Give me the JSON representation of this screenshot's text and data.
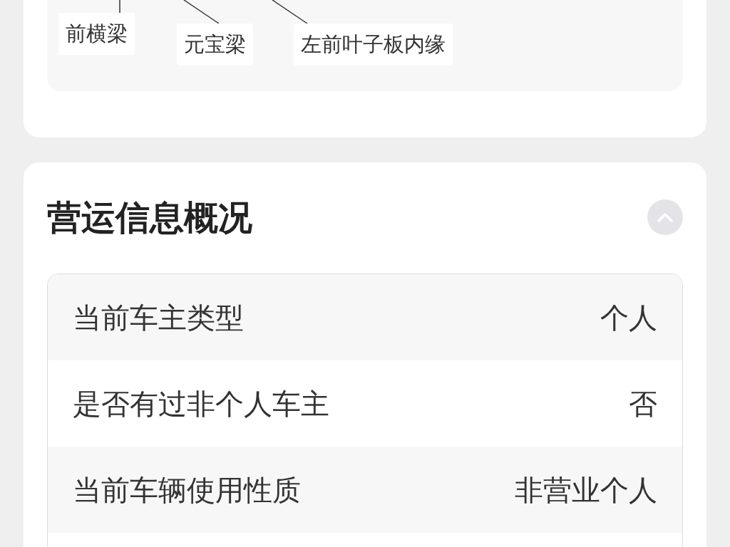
{
  "damage_diagram": {
    "labels": [
      {
        "text": "前横梁"
      },
      {
        "text": "元宝梁"
      },
      {
        "text": "左前叶子板内缘"
      }
    ]
  },
  "operation_info": {
    "title": "营运信息概况",
    "expanded": true,
    "rows": [
      {
        "label": "当前车主类型",
        "value": "个人"
      },
      {
        "label": "是否有过非个人车主",
        "value": "否"
      },
      {
        "label": "当前车辆使用性质",
        "value": "非营业个人"
      }
    ]
  }
}
